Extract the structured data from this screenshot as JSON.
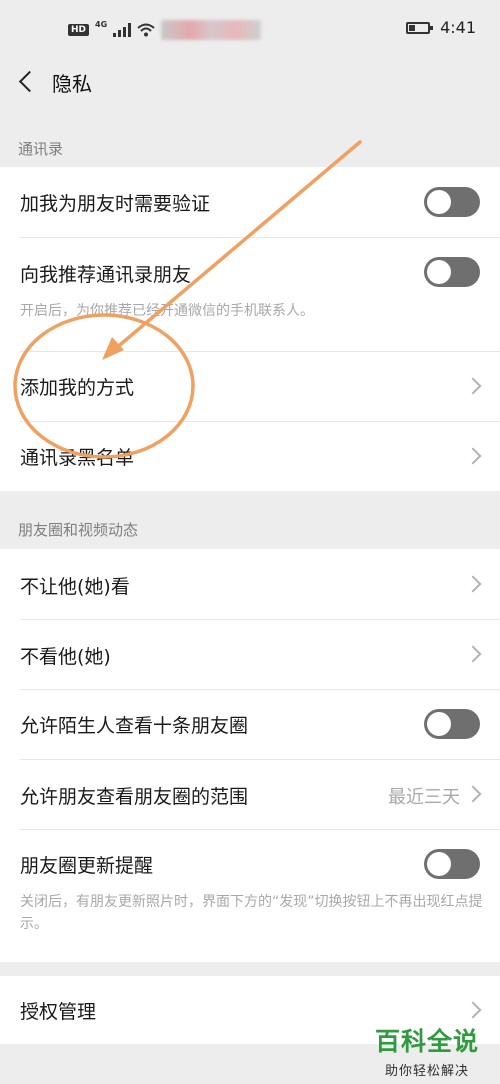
{
  "status_bar": {
    "hd": "HD",
    "network": "4G",
    "time": "4:41"
  },
  "nav": {
    "title": "隐私"
  },
  "sections": {
    "contacts": {
      "label": "通讯录",
      "items": [
        {
          "label": "加我为朋友时需要验证",
          "control": "toggle",
          "state": "off"
        },
        {
          "label": "向我推荐通讯录朋友",
          "control": "toggle",
          "state": "off",
          "description": "开启后，为你推荐已经开通微信的手机联系人。"
        },
        {
          "label": "添加我的方式",
          "control": "chevron"
        },
        {
          "label": "通讯录黑名单",
          "control": "chevron"
        }
      ]
    },
    "moments": {
      "label": "朋友圈和视频动态",
      "items": [
        {
          "label": "不让他(她)看",
          "control": "chevron"
        },
        {
          "label": "不看他(她)",
          "control": "chevron"
        },
        {
          "label": "允许陌生人查看十条朋友圈",
          "control": "toggle",
          "state": "off"
        },
        {
          "label": "允许朋友查看朋友圈的范围",
          "control": "chevron",
          "value": "最近三天"
        },
        {
          "label": "朋友圈更新提醒",
          "control": "toggle",
          "state": "off",
          "description": "关闭后，有朋友更新照片时，界面下方的“发现”切换按钮上不再出现红点提示。"
        }
      ]
    },
    "auth": {
      "items": [
        {
          "label": "授权管理",
          "control": "chevron"
        }
      ]
    }
  },
  "colors": {
    "background": "#ededed",
    "row_background": "#ffffff",
    "toggle_off": "#6f6f6f",
    "annotation": "#f0a060",
    "watermark_green": "#2f9a3f"
  },
  "watermark": {
    "main": "百科全说",
    "sub": "助你轻松解决"
  }
}
